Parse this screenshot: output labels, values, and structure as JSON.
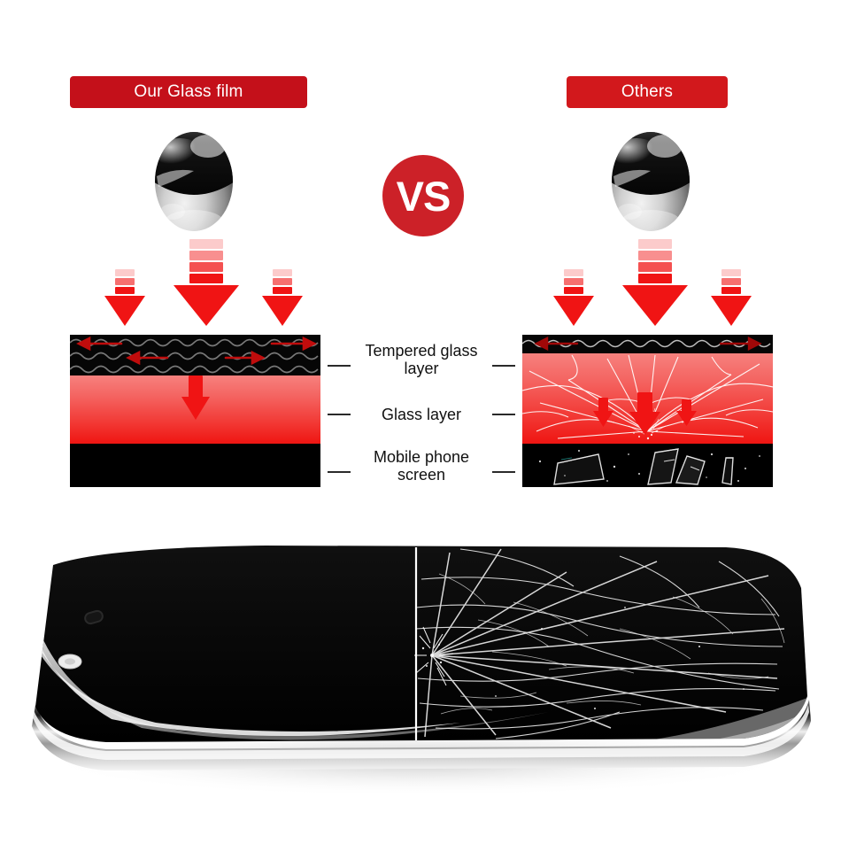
{
  "meta": {
    "kind": "product-comparison-infographic",
    "background": "#ffffff",
    "accent_red": "#C4101A",
    "vs_red": "#CC2128",
    "glass_red_top": "#F6817E",
    "glass_red_bottom": "#EF1512"
  },
  "headers": {
    "left": {
      "label": "Our Glass film",
      "bg": "#C4101A",
      "text_color": "#ffffff"
    },
    "right": {
      "label": "Others",
      "bg": "#D2181C",
      "text_color": "#ffffff"
    }
  },
  "vs_badge": {
    "label": "VS",
    "bg": "#CC2128",
    "text_color": "#ffffff"
  },
  "impact": {
    "left_ball": {
      "name": "steel-ball",
      "description": "chrome impact ball"
    },
    "right_ball": {
      "name": "steel-ball",
      "description": "chrome impact ball"
    },
    "arrow_count": 3,
    "arrow_color": "#F01414"
  },
  "legend": {
    "rows": [
      {
        "label": "Tempered glass layer",
        "line1": "Tempered glass",
        "line2": "layer",
        "dash": true
      },
      {
        "label": "Glass layer",
        "line1": "Glass layer",
        "line2": "",
        "dash": true
      },
      {
        "label": "Mobile phone screen",
        "line1": "Mobile phone",
        "line2": "screen",
        "dash": true
      }
    ]
  },
  "panels": {
    "left": {
      "name": "our-glass-film-cross-section",
      "outcome": "intact",
      "layers": [
        {
          "name": "tempered-glass-layer",
          "fill": "black-with-grey-waves",
          "force": "dispersed-sideways"
        },
        {
          "name": "glass-layer",
          "fill": "red-gradient",
          "force": "single-downward-arrow"
        },
        {
          "name": "mobile-phone-screen",
          "fill": "black",
          "state": "undamaged"
        }
      ]
    },
    "right": {
      "name": "others-cross-section",
      "outcome": "shattered",
      "layers": [
        {
          "name": "tempered-glass-layer",
          "fill": "black-with-grey-waves",
          "force": "dispersed-sideways"
        },
        {
          "name": "glass-layer",
          "fill": "red-gradient-cracked",
          "force": "three-downward-arrows"
        },
        {
          "name": "mobile-phone-screen",
          "fill": "black-with-glass-shards",
          "state": "shattered"
        }
      ]
    }
  },
  "phone": {
    "name": "phone-comparison-photo",
    "left_half": {
      "state": "pristine",
      "description": "clean black screen with glossy reflection"
    },
    "right_half": {
      "state": "cracked",
      "description": "spiderweb shattered screen"
    },
    "features": [
      "earpiece-slot",
      "front-camera",
      "divider-line"
    ]
  }
}
